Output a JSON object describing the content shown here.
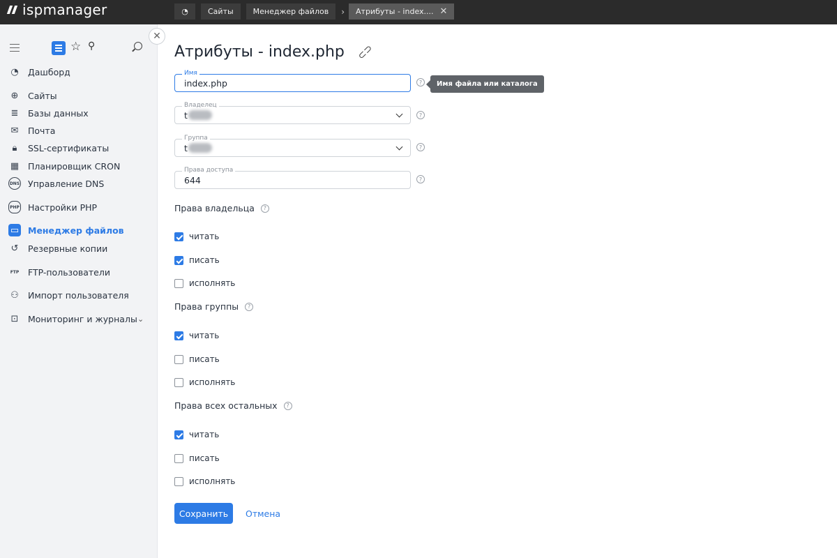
{
  "app": {
    "logo_text": "ispmanager"
  },
  "breadcrumbs": [
    {
      "label": "Сайты"
    },
    {
      "label": "Менеджер файлов"
    },
    {
      "label": "Атрибуты - index...."
    }
  ],
  "sidebar": {
    "items": [
      {
        "label": "Дашборд",
        "icon": "dashboard-icon"
      },
      {
        "label": "Сайты",
        "icon": "globe-icon"
      },
      {
        "label": "Базы данных",
        "icon": "database-icon"
      },
      {
        "label": "Почта",
        "icon": "mail-icon"
      },
      {
        "label": "SSL-сертификаты",
        "icon": "lock-icon"
      },
      {
        "label": "Планировщик CRON",
        "icon": "calendar-icon"
      },
      {
        "label": "Управление DNS",
        "icon": "dns-icon",
        "icon_text": "DNS"
      },
      {
        "label": "Настройки PHP",
        "icon": "php-icon",
        "icon_text": "PHP"
      },
      {
        "label": "Менеджер файлов",
        "icon": "folder-icon",
        "active": true
      },
      {
        "label": "Резервные копии",
        "icon": "backup-icon"
      },
      {
        "label": "FTP-пользователи",
        "icon": "ftp-icon",
        "icon_text": "FTP"
      },
      {
        "label": "Импорт пользователя",
        "icon": "user-import-icon"
      },
      {
        "label": "Мониторинг и журналы",
        "icon": "monitoring-icon"
      }
    ]
  },
  "form": {
    "title": "Атрибуты - index.php",
    "name_label": "Имя",
    "name_value": "index.php",
    "name_tooltip": "Имя файла или каталога",
    "owner_label": "Владелец",
    "owner_value": "t",
    "group_label": "Группа",
    "group_value": "t",
    "access_label": "Права доступа",
    "access_value": "644",
    "owner_rights": "Права владельца",
    "group_rights": "Права группы",
    "other_rights": "Права всех остальных",
    "read": "читать",
    "write": "писать",
    "execute": "исполнять",
    "help_mark": "?",
    "checks": {
      "owner": [
        true,
        true,
        false
      ],
      "group": [
        true,
        false,
        false
      ],
      "other": [
        true,
        false,
        false
      ]
    },
    "save_label": "Сохранить",
    "cancel_label": "Отмена"
  },
  "colors": {
    "accent": "#2d7be5",
    "topbar": "#2b2b2b",
    "sidebar": "#f2f3f5"
  }
}
